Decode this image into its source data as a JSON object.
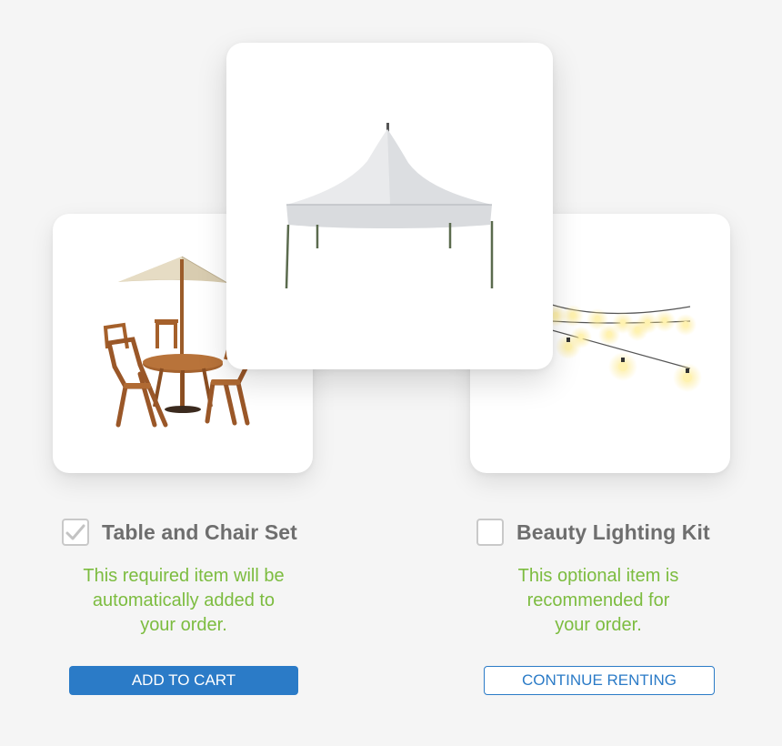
{
  "products": {
    "left": {
      "image": "patio-table-umbrella-chairs",
      "checked": true,
      "title": "Table and Chair Set",
      "description_lines": [
        "This required item will be",
        "automatically added to",
        "your order."
      ]
    },
    "center": {
      "image": "white-peak-tent"
    },
    "right": {
      "image": "string-lights",
      "checked": false,
      "title": "Beauty Lighting Kit",
      "description_lines": [
        "This optional item is",
        "recommended for",
        "your order."
      ]
    }
  },
  "actions": {
    "add_to_cart": "ADD TO CART",
    "continue_renting": "CONTINUE RENTING"
  },
  "colors": {
    "background": "#f5f5f5",
    "accent_blue": "#2b7bc7",
    "description_green": "#7cbc3f",
    "title_gray": "#6e6e6e",
    "checkbox_border": "#c9c9c9"
  }
}
